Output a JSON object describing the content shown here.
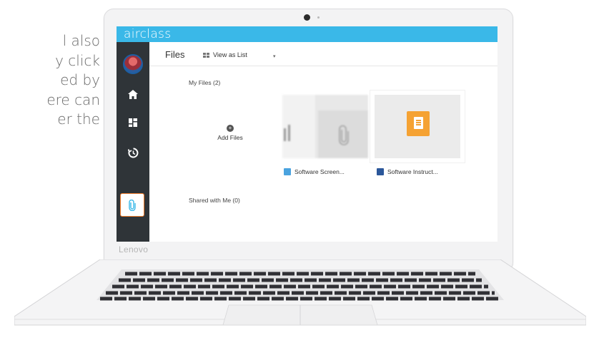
{
  "caption_lines": [
    "l also",
    "y click",
    "ed by",
    "ere can",
    "er the"
  ],
  "laptop": {
    "brand": "Lenovo"
  },
  "app": {
    "logo": "airclass",
    "accent": "#3ab8e8",
    "sidebar": {
      "items": [
        {
          "icon": "avatar"
        },
        {
          "icon": "home-icon"
        },
        {
          "icon": "dashboard-icon"
        },
        {
          "icon": "history-icon"
        },
        {
          "icon": "paperclip-icon",
          "active": true
        }
      ]
    },
    "header": {
      "title": "Files",
      "view_label": "View as List",
      "caret": "▾"
    },
    "my_files": {
      "label": "My Files (2)",
      "add_label": "Add Files",
      "add_icon": "+",
      "files": [
        {
          "name": "Software Screen...",
          "icon": "image-file-icon"
        },
        {
          "name": "Software Instruct...",
          "icon": "word-file-icon"
        }
      ]
    },
    "shared": {
      "label": "Shared with Me (0)"
    }
  }
}
